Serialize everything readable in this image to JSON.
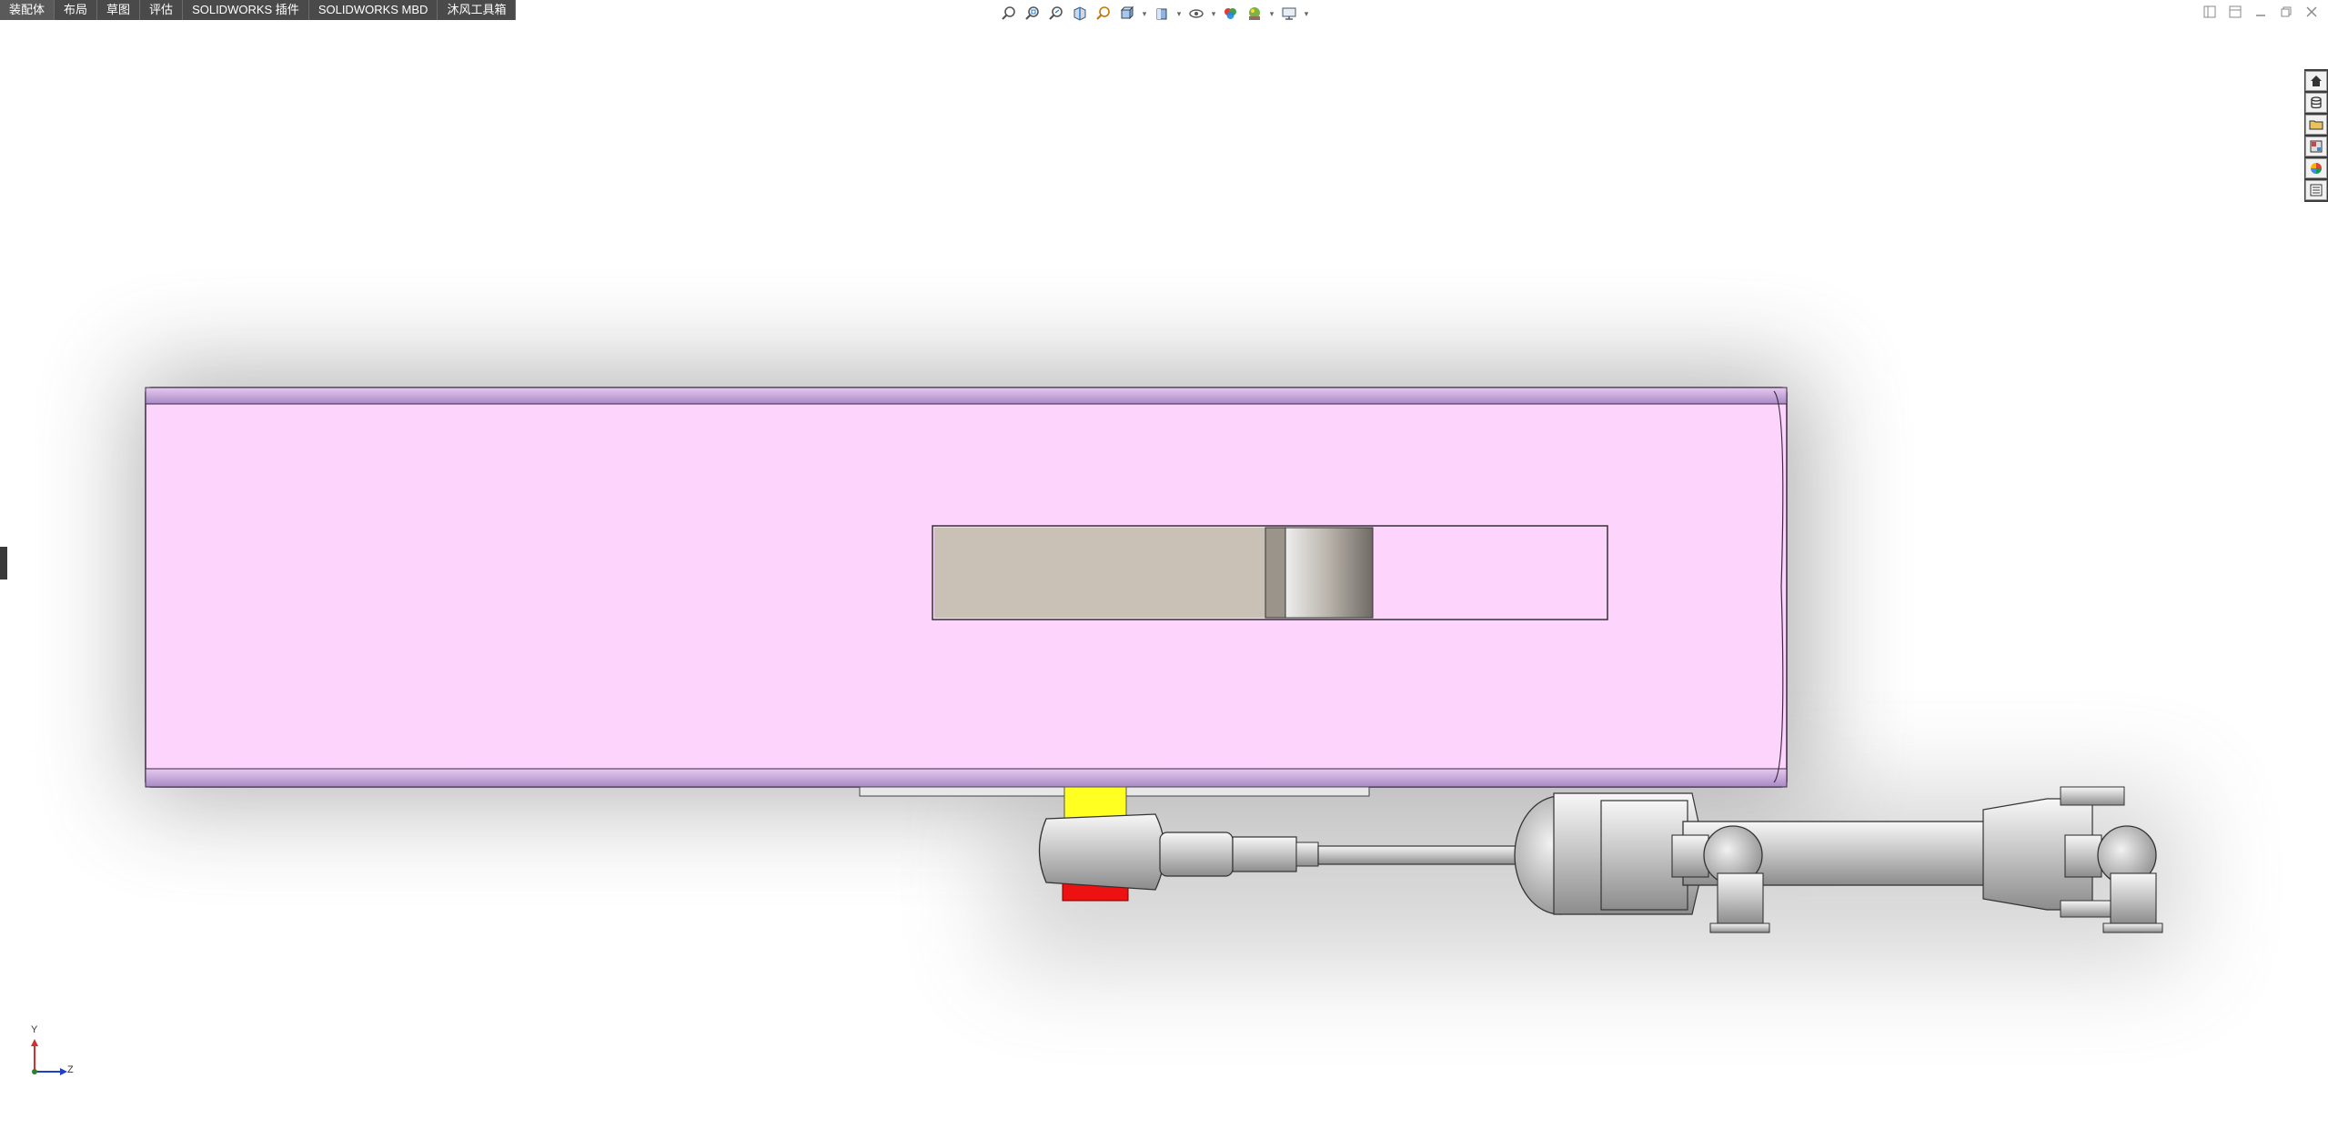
{
  "tabs": [
    {
      "label": "装配体",
      "active": true
    },
    {
      "label": "布局",
      "active": false
    },
    {
      "label": "草图",
      "active": false
    },
    {
      "label": "评估",
      "active": false
    },
    {
      "label": "SOLIDWORKS 插件",
      "active": false
    },
    {
      "label": "SOLIDWORKS MBD",
      "active": false
    },
    {
      "label": "沐风工具箱",
      "active": false
    }
  ],
  "hud_icons": [
    "zoom-to-fit-icon",
    "zoom-to-area-icon",
    "previous-view-icon",
    "section-view-icon",
    "dynamic-annotation-icon",
    "view-orientation-icon",
    "display-style-icon",
    "hide-show-icon",
    "edit-appearance-icon",
    "apply-scene-icon",
    "view-settings-icon"
  ],
  "task_pane_icons": [
    "home-icon",
    "resources-icon",
    "file-explorer-icon",
    "view-palette-icon",
    "appearances-icon",
    "custom-properties-icon"
  ],
  "triad": {
    "vertical_axis": "Y",
    "horizontal_axis": "Z"
  },
  "colors": {
    "tabbar_bg": "#4a4a4a",
    "panel_pink": "#fcd4fc",
    "panel_edge": "#c9a4d8",
    "slot_tan": "#c9c1b6",
    "pin_yellow": "#ffff22",
    "nut_red": "#ee1111",
    "metal": "#d7d7d7"
  }
}
